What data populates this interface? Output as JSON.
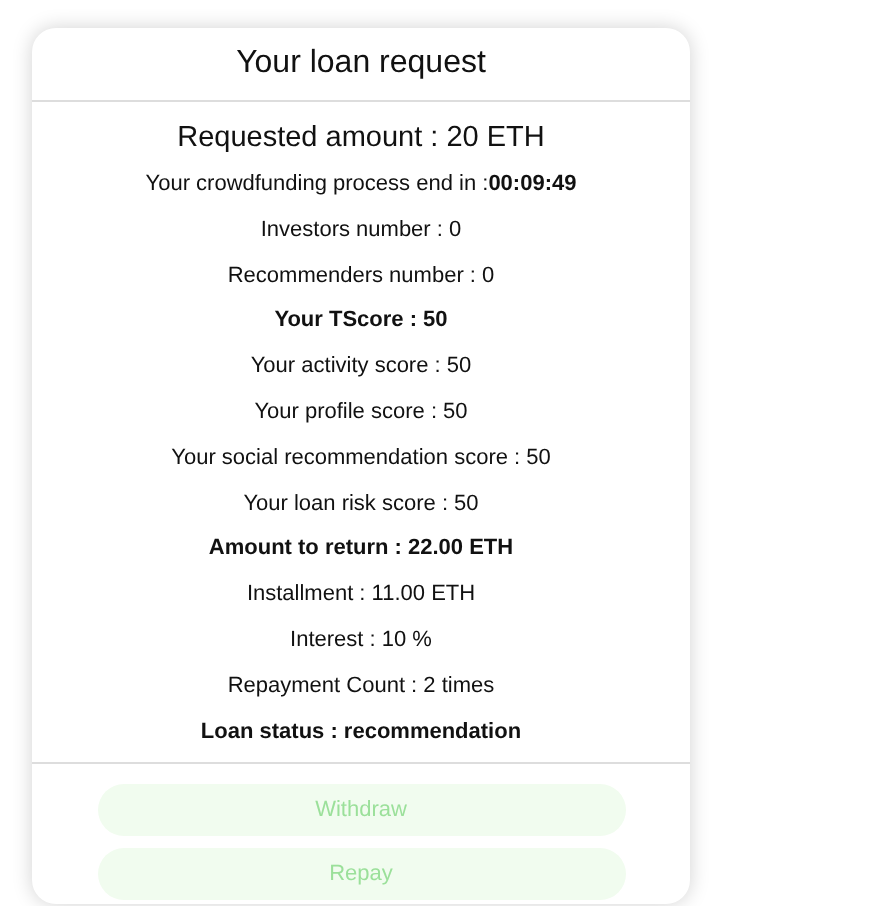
{
  "title": "Your loan request",
  "lines": [
    {
      "kind": "heading",
      "text": "Requested amount : 20 ETH"
    },
    {
      "kind": "normal",
      "text": "Your crowdfunding process end in :**00:09:49**"
    },
    {
      "kind": "normal",
      "text": "Investors number : 0"
    },
    {
      "kind": "normal",
      "text": "Recommenders number : 0"
    },
    {
      "kind": "bold",
      "text": "Your TScore : 50"
    },
    {
      "kind": "normal",
      "text": "Your activity score : 50"
    },
    {
      "kind": "normal",
      "text": "Your profile score : 50"
    },
    {
      "kind": "normal",
      "text": "Your social recommendation score : 50"
    },
    {
      "kind": "normal",
      "text": "Your loan risk score : 50"
    },
    {
      "kind": "bold",
      "text": "Amount to return : 22.00 ETH"
    },
    {
      "kind": "normal",
      "text": "Installment : 11.00 ETH"
    },
    {
      "kind": "normal",
      "text": "Interest : 10 %"
    },
    {
      "kind": "normal",
      "text": "Repayment Count : 2 times"
    },
    {
      "kind": "bold",
      "text": "Loan status : recommendation"
    }
  ],
  "buttons": [
    {
      "label": "Withdraw",
      "disabled": true
    },
    {
      "label": "Repay",
      "disabled": true
    }
  ]
}
